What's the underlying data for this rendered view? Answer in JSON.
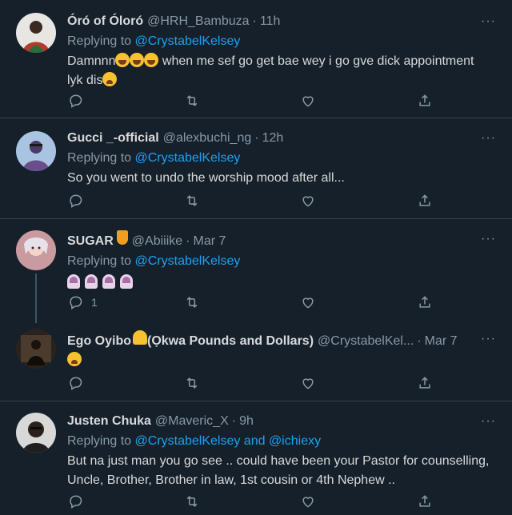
{
  "tweets": [
    {
      "name": "Óró of Óloró",
      "handle": "@HRH_Bambuza",
      "time": "11h",
      "reply_prefix": "Replying to",
      "reply_to": "@CrystabelKelsey",
      "text_a": "Damnnn",
      "text_b": " when me sef go get bae wey i go gve dick appointment",
      "text_c": "lyk dis",
      "more": "···",
      "reply_count": ""
    },
    {
      "name": "Gucci _-official",
      "handle": "@alexbuchi_ng",
      "time": "12h",
      "reply_prefix": "Replying to",
      "reply_to": "@CrystabelKelsey",
      "text": "So you went to undo the worship mood after all...",
      "more": "···",
      "reply_count": ""
    },
    {
      "name": "SUGAR",
      "handle": "@Abiiike",
      "time": "Mar 7",
      "reply_prefix": "Replying to",
      "reply_to": "@CrystabelKelsey",
      "more": "···",
      "reply_count": "1"
    },
    {
      "name": "Ego Oyibo",
      "name_suffix": " (Ọkwa Pounds and Dollars)",
      "handle": "@CrystabelKel...",
      "time": "Mar 7",
      "more": "···",
      "reply_count": ""
    },
    {
      "name": "Justen Chuka",
      "handle": "@Maveric_X",
      "time": "9h",
      "reply_prefix": "Replying to",
      "reply_to": "@CrystabelKelsey",
      "reply_and": " and ",
      "reply_to_2": "@ichiexy",
      "text_line1": "But na just man you go see .. could have been your Pastor for counselling,",
      "text_line2": "Uncle, Brother, Brother in law, 1st cousin or 4th Nephew ..",
      "more": "···",
      "reply_count": ""
    }
  ],
  "icons": [
    "reply-icon",
    "retweet-icon",
    "like-icon",
    "share-icon",
    "more-icon"
  ],
  "colors": {
    "background": "#15202b",
    "link": "#1da1f2",
    "muted": "#8899a6",
    "divider": "#38444d"
  }
}
